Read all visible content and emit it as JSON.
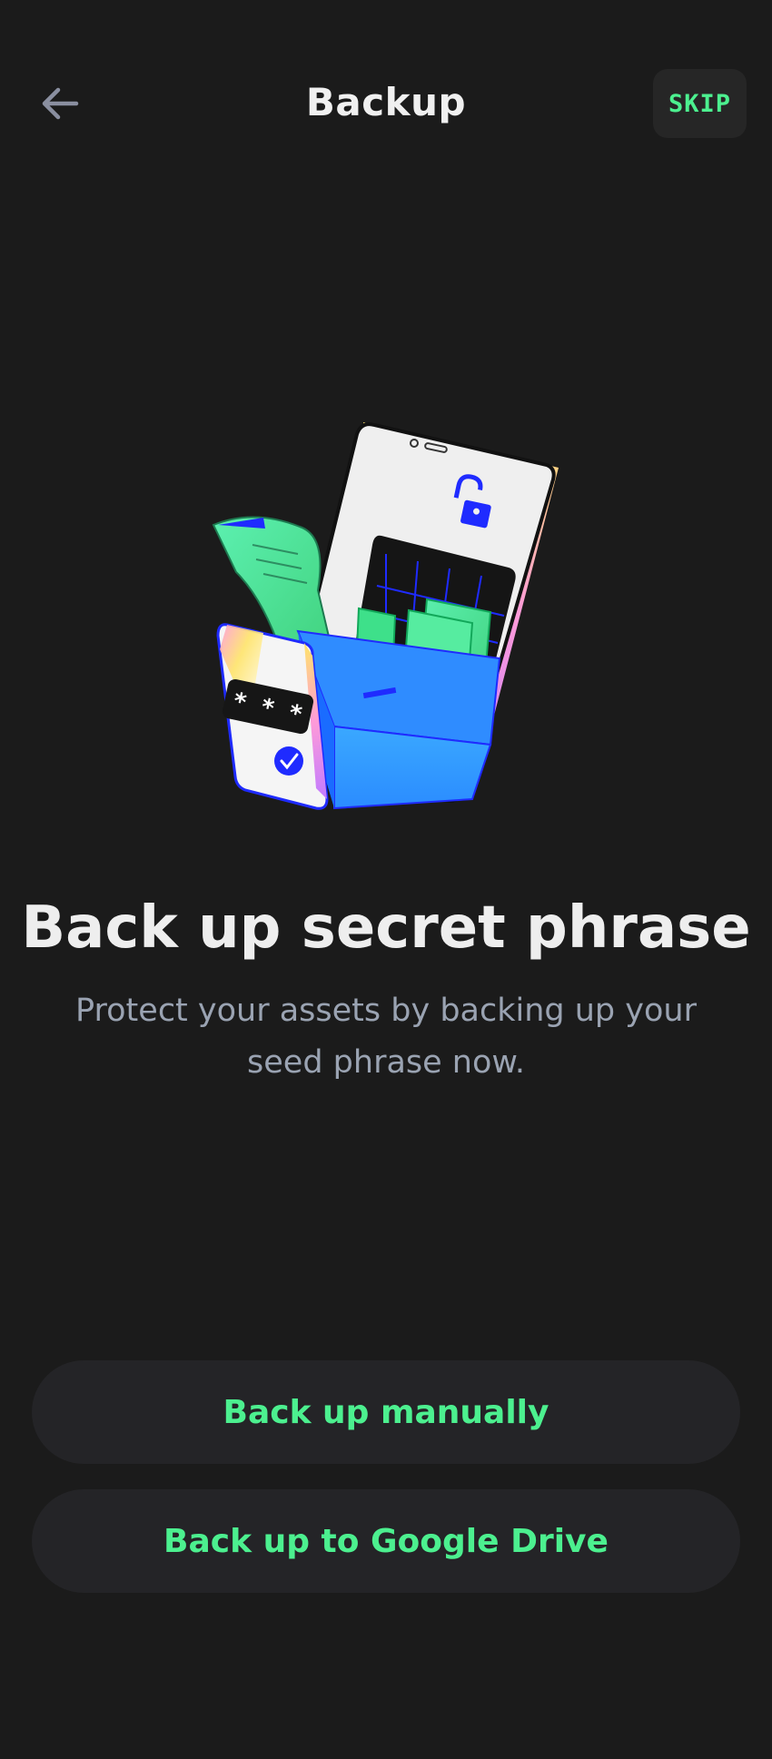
{
  "header": {
    "title": "Backup",
    "back_icon": "arrow-left-icon",
    "skip_label": "SKIP"
  },
  "illustration": {
    "name": "backup-illustration",
    "password_mask": "* * *"
  },
  "content": {
    "headline": "Back up secret phrase",
    "description": "Protect your assets by backing up your seed phrase now."
  },
  "actions": {
    "manual_label": "Back up manually",
    "drive_label": "Back up to Google Drive"
  },
  "colors": {
    "background": "#1b1b1b",
    "accent": "#4cf08f",
    "button_bg": "#242427",
    "subtext": "#9aa3b2"
  }
}
